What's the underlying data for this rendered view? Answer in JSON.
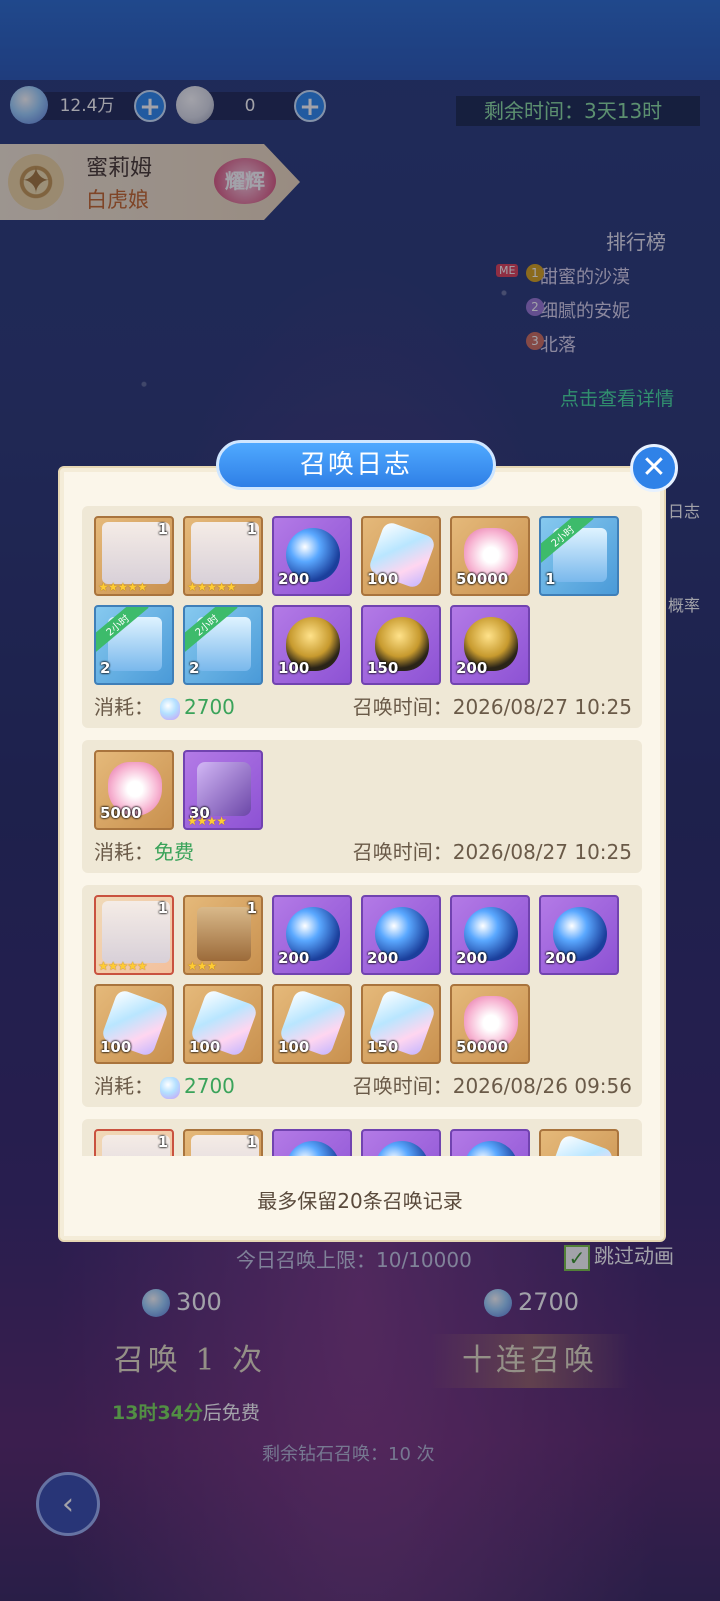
{
  "resources": {
    "diamond": "12.4万",
    "pearl": "0"
  },
  "timer": "剩余时间：3天13时",
  "hero": {
    "name": "蜜莉姆",
    "sub": "白虎娘",
    "badge": "耀辉"
  },
  "ranking": {
    "title": "排行榜",
    "me": "ME",
    "rows": [
      "甜蜜的沙漠",
      "细腻的安妮",
      "北落"
    ]
  },
  "detail_link": "点击查看详情",
  "side": {
    "log": "日志",
    "rate": "概率"
  },
  "modal": {
    "title": "召唤日志",
    "cost_label": "消耗：",
    "time_label": "召唤时间：",
    "footer": "最多保留20条召唤记录",
    "records": [
      {
        "cost": "2700",
        "time": "2026/08/27 10:25",
        "items": [
          {
            "kind": "hero",
            "bg": "gold",
            "count": "1",
            "stars": "★★★★★"
          },
          {
            "kind": "hero",
            "bg": "gold",
            "count": "1",
            "stars": "★★★★★"
          },
          {
            "kind": "orb",
            "bg": "purple",
            "count": "200"
          },
          {
            "kind": "crystal",
            "bg": "gold",
            "count": "100"
          },
          {
            "kind": "heart",
            "bg": "gold",
            "count": "50000"
          },
          {
            "kind": "chest",
            "bg": "blue",
            "count": "1",
            "tag": "2小时"
          },
          {
            "kind": "chest",
            "bg": "blue",
            "count": "2",
            "tag": "2小时"
          },
          {
            "kind": "chest",
            "bg": "blue",
            "count": "2",
            "tag": "2小时"
          },
          {
            "kind": "egg",
            "bg": "purple",
            "count": "100"
          },
          {
            "kind": "egg",
            "bg": "purple",
            "count": "150"
          },
          {
            "kind": "egg",
            "bg": "purple",
            "count": "200"
          }
        ]
      },
      {
        "cost": "免费",
        "time": "2026/08/27 10:25",
        "items": [
          {
            "kind": "heart",
            "bg": "gold",
            "count": "5000"
          },
          {
            "kind": "gem",
            "bg": "purple",
            "count": "30",
            "stars": "★★★★"
          }
        ]
      },
      {
        "cost": "2700",
        "time": "2026/08/26 09:56",
        "items": [
          {
            "kind": "hero",
            "bg": "red",
            "count": "1",
            "stars": "★★★★★"
          },
          {
            "kind": "box",
            "bg": "gold",
            "count": "1",
            "stars": "★★★"
          },
          {
            "kind": "orb",
            "bg": "purple",
            "count": "200"
          },
          {
            "kind": "orb",
            "bg": "purple",
            "count": "200"
          },
          {
            "kind": "orb",
            "bg": "purple",
            "count": "200"
          },
          {
            "kind": "orb",
            "bg": "purple",
            "count": "200"
          },
          {
            "kind": "crystal",
            "bg": "gold",
            "count": "100"
          },
          {
            "kind": "crystal",
            "bg": "gold",
            "count": "100"
          },
          {
            "kind": "crystal",
            "bg": "gold",
            "count": "100"
          },
          {
            "kind": "crystal",
            "bg": "gold",
            "count": "150"
          },
          {
            "kind": "heart",
            "bg": "gold",
            "count": "50000"
          }
        ]
      },
      {
        "cost": "",
        "time": "",
        "items": [
          {
            "kind": "hero",
            "bg": "red",
            "count": "1"
          },
          {
            "kind": "hero",
            "bg": "gold",
            "count": "1"
          },
          {
            "kind": "orb",
            "bg": "purple",
            "count": ""
          },
          {
            "kind": "orb",
            "bg": "purple",
            "count": ""
          },
          {
            "kind": "orb",
            "bg": "purple",
            "count": ""
          },
          {
            "kind": "crystal",
            "bg": "gold",
            "count": ""
          }
        ]
      }
    ]
  },
  "bottom": {
    "limit": "今日召唤上限：10/10000",
    "skip": "跳过动画",
    "cost_single": "300",
    "cost_ten": "2700",
    "btn_single": "召唤 1 次",
    "btn_ten": "十连召唤",
    "free_time": "13时34分",
    "free_suffix": "后免费",
    "remain": "剩余钻石召唤：10 次"
  }
}
